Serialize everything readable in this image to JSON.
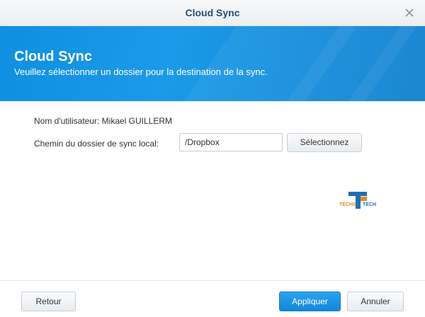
{
  "window": {
    "title": "Cloud Sync"
  },
  "banner": {
    "heading": "Cloud Sync",
    "subheading": "Veuillez sélectionner un dossier pour la destination de la sync."
  },
  "form": {
    "user_label": "Nom d'utilisateur: Mikael GUILLERM",
    "path_label": "Chemin du dossier de sync local:",
    "path_value": "/Dropbox",
    "select_button": "Sélectionnez"
  },
  "watermark": {
    "text_left": "TECHS",
    "text_right": "TECH"
  },
  "footer": {
    "back_button": "Retour",
    "apply_button": "Appliquer",
    "cancel_button": "Annuler"
  },
  "colors": {
    "banner_blue": "#1a9ae8",
    "primary_button": "#1286d8",
    "title_text": "#1e4f7a"
  },
  "icons": [
    "close-icon",
    "logo-icon"
  ]
}
